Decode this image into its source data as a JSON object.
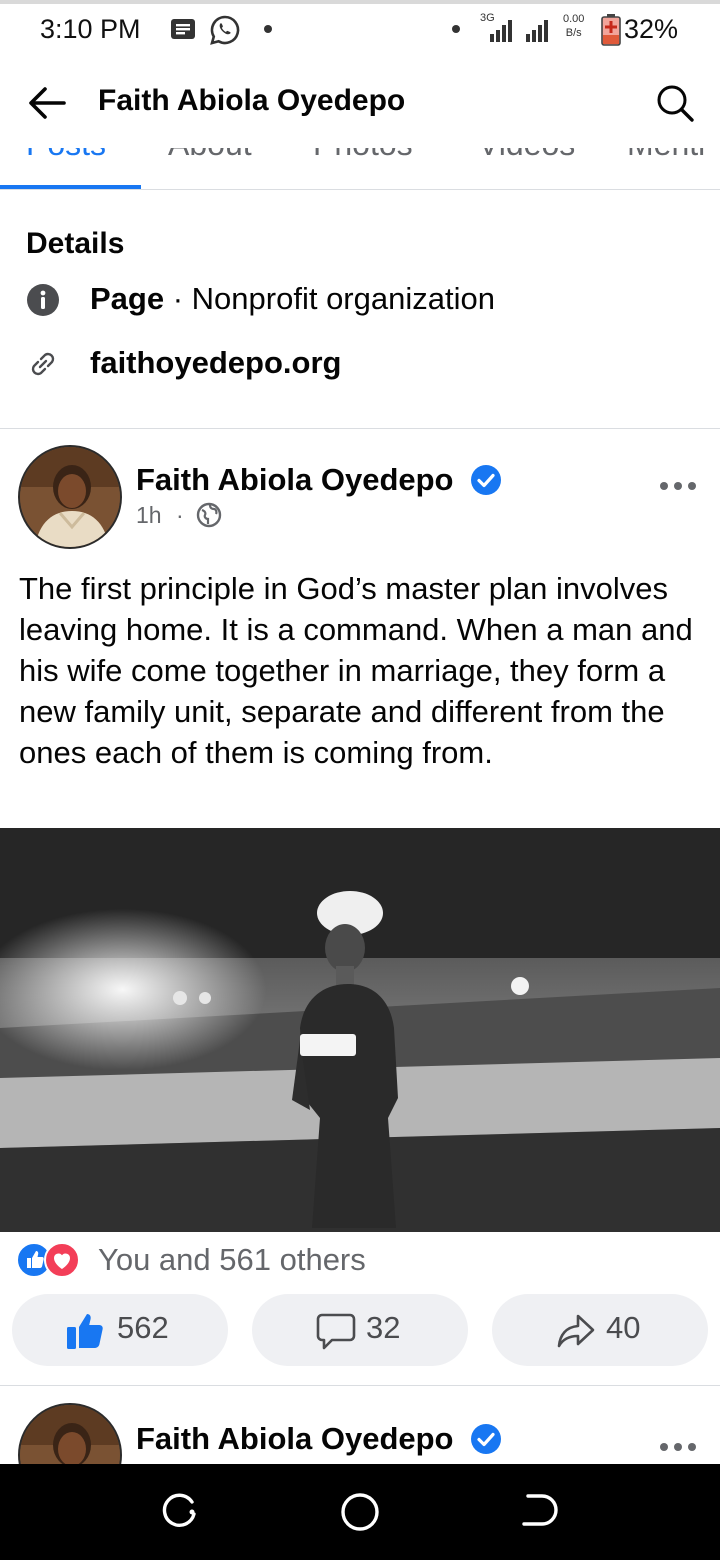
{
  "status_bar": {
    "time": "3:10 PM",
    "network_label": "3G",
    "net_speed_value": "0.00",
    "net_speed_unit": "B/s",
    "battery": "32%",
    "icons": [
      "message-icon",
      "whatsapp-icon",
      "signal-icon",
      "battery-charging-icon"
    ]
  },
  "header": {
    "title": "Faith Abiola Oyedepo"
  },
  "tabs": [
    {
      "label": "Posts",
      "active": true
    },
    {
      "label": "About",
      "active": false
    },
    {
      "label": "Photos",
      "active": false
    },
    {
      "label": "Videos",
      "active": false
    },
    {
      "label": "Menti",
      "active": false
    }
  ],
  "details": {
    "title": "Details",
    "category_label": "Page",
    "category_separator": " · ",
    "category_value": "Nonprofit organization",
    "website": "faithoyedepo.org"
  },
  "post": {
    "author": "Faith Abiola Oyedepo",
    "time": "1h",
    "meta_separator": "·",
    "text": "The first principle in God’s master plan involves leaving home. It is a command. When a man and his wife come together in marriage, they form a new family unit, separate and different from the ones each of them is coming from.",
    "reactions_text": "You and 561 others",
    "likes": "562",
    "comments": "32",
    "shares": "40"
  },
  "next_post": {
    "author": "Faith Abiola Oyedepo"
  },
  "colors": {
    "brand_blue": "#1877f2",
    "love_red": "#f33e58",
    "secondary_text": "#65676b",
    "button_bg": "#eff0f3"
  }
}
